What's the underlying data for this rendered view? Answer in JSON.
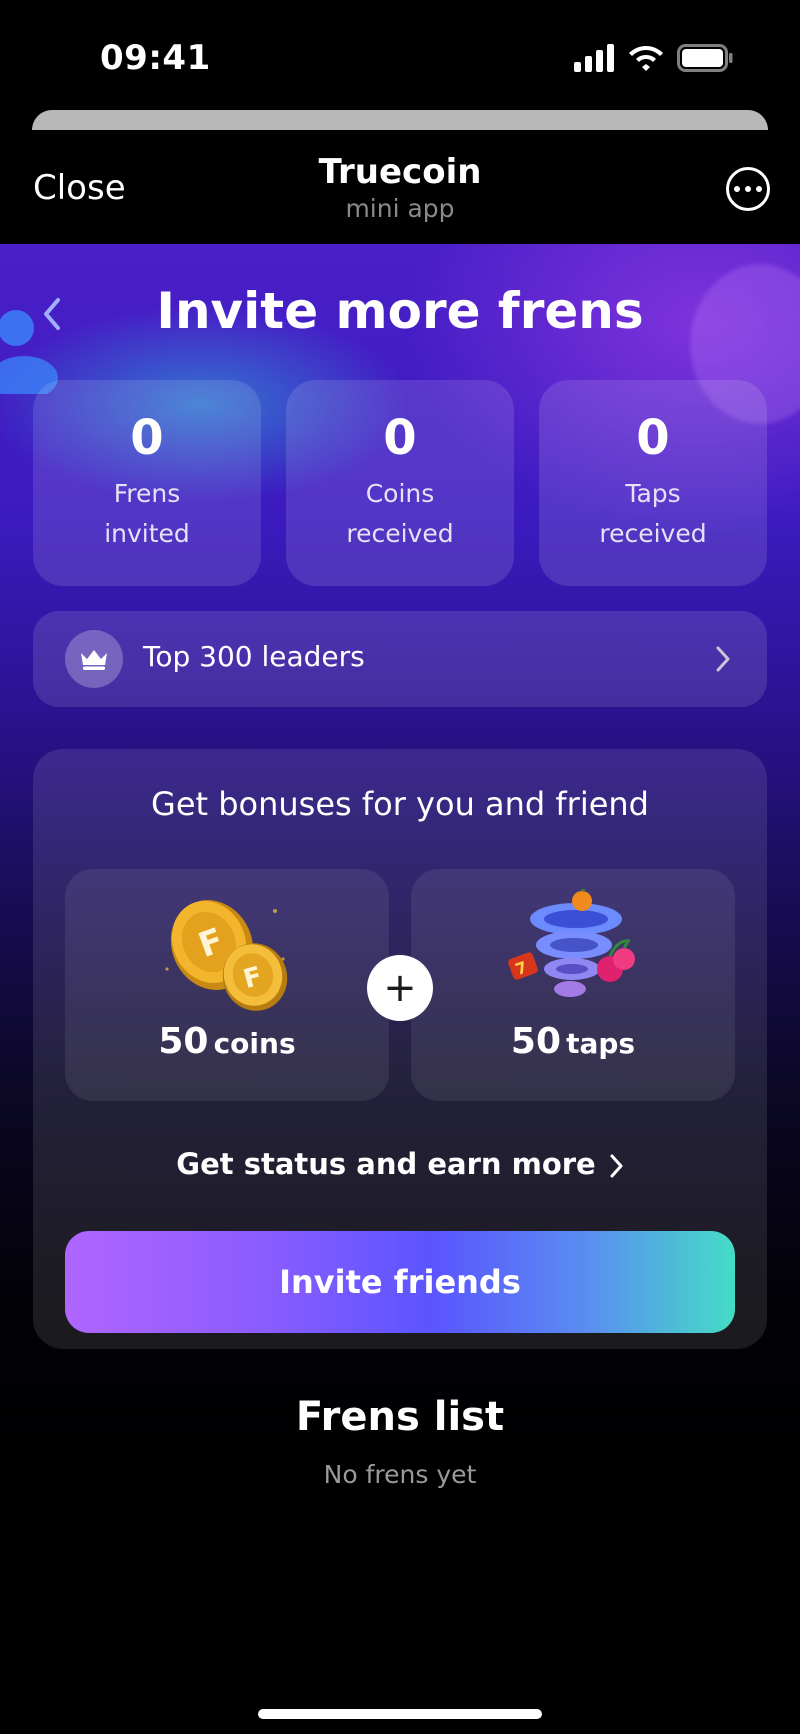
{
  "status_bar": {
    "time": "09:41"
  },
  "header": {
    "close_label": "Close",
    "title": "Truecoin",
    "subtitle": "mini app"
  },
  "page": {
    "title": "Invite more frens"
  },
  "stats": [
    {
      "value": "0",
      "label": "Frens\ninvited"
    },
    {
      "value": "0",
      "label": "Coins\nreceived"
    },
    {
      "value": "0",
      "label": "Taps\nreceived"
    }
  ],
  "leaders": {
    "label": "Top 300 leaders"
  },
  "bonus": {
    "title": "Get bonuses for you and friend",
    "left": {
      "amount": "50",
      "unit": "coins"
    },
    "right": {
      "amount": "50",
      "unit": "taps"
    },
    "plus": "+",
    "status_link": "Get status and earn more",
    "invite_button": "Invite friends"
  },
  "frens_list": {
    "title": "Frens list",
    "empty_text": "No frens yet"
  },
  "colors": {
    "accent_gradient": [
      "#b065ff",
      "#5a55ff",
      "#44dcc6"
    ],
    "background_top": "#4a1fc8"
  }
}
